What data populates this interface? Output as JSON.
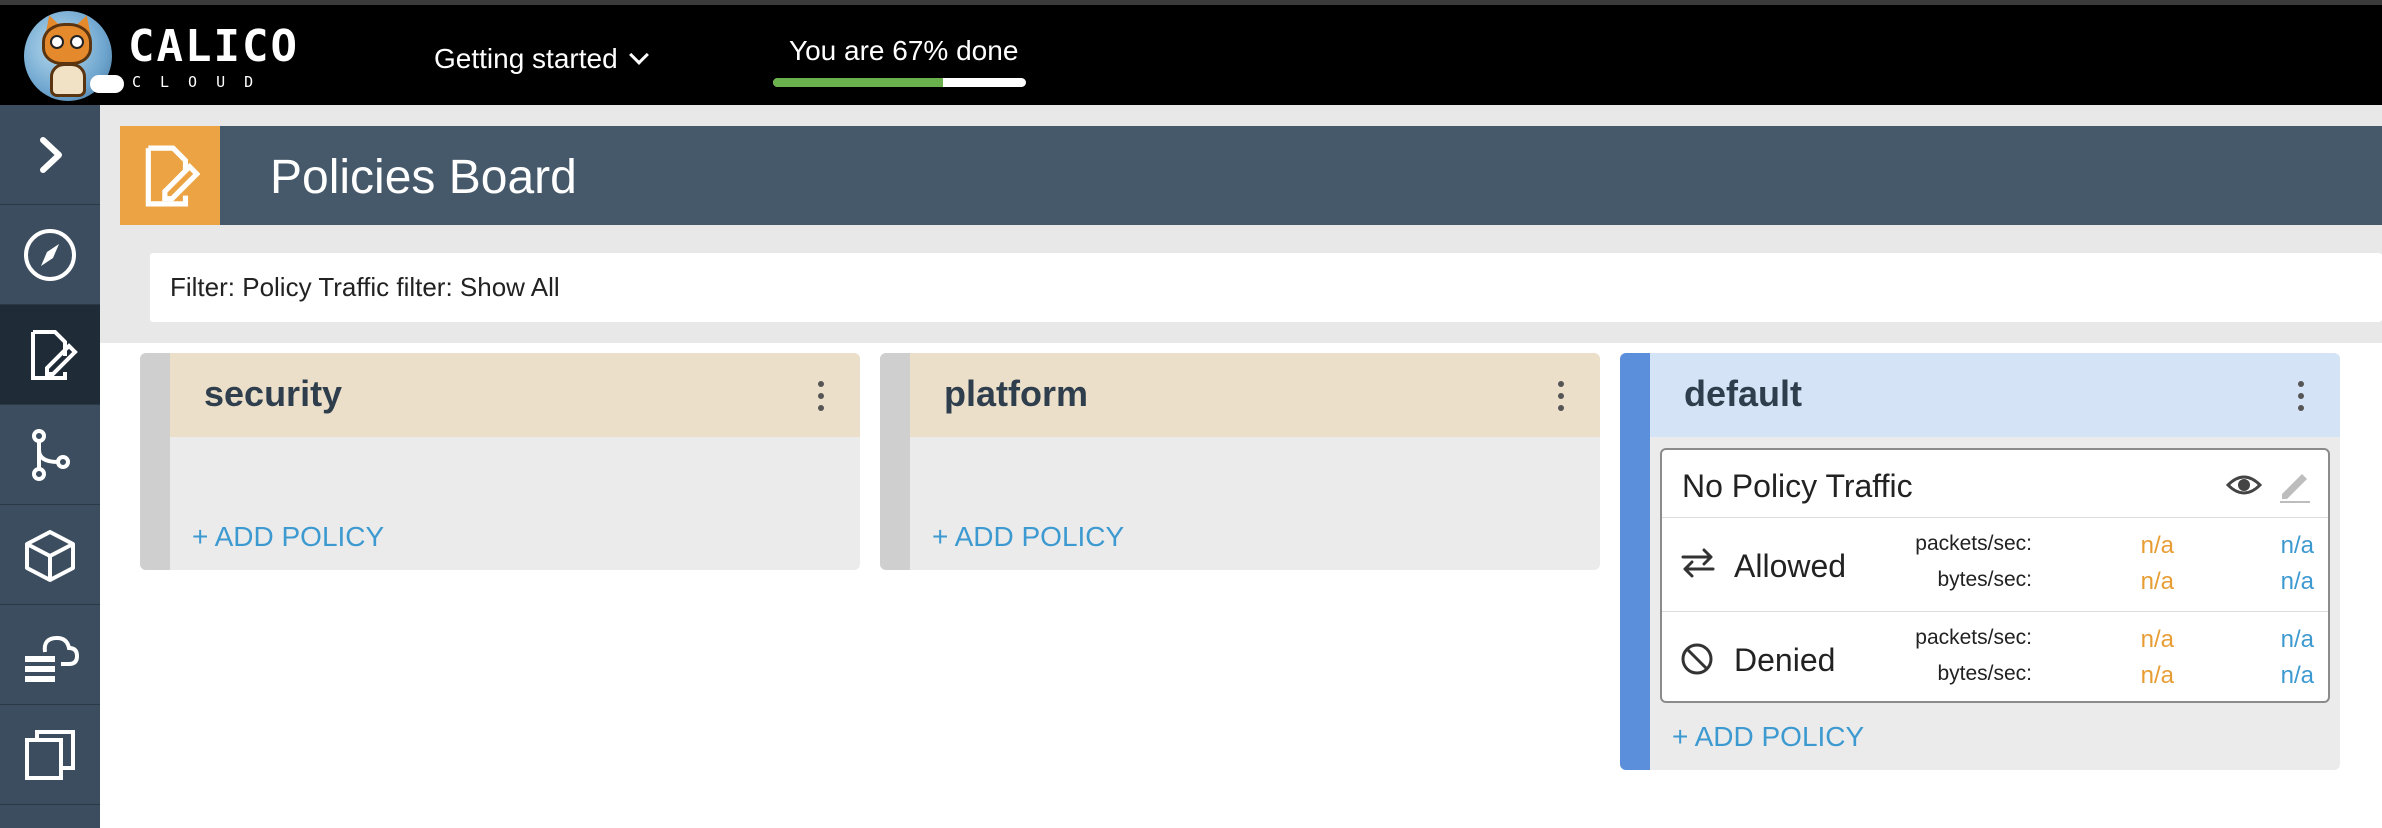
{
  "topbar": {
    "logo_text": "CALICO",
    "logo_sub": "CLOUD",
    "menu_label": "Getting started",
    "progress_text": "You are 67% done",
    "progress_fraction": 0.67,
    "progress_color": "#6ab04c"
  },
  "sidebar": {
    "items": [
      {
        "name": "expand",
        "icon": "chevron-right-icon"
      },
      {
        "name": "dashboard",
        "icon": "compass-icon"
      },
      {
        "name": "policies",
        "icon": "policy-edit-icon",
        "active": true
      },
      {
        "name": "service-graph",
        "icon": "graph-branch-icon"
      },
      {
        "name": "endpoints",
        "icon": "cube-icon"
      },
      {
        "name": "managed-cluster",
        "icon": "cloud-server-icon"
      },
      {
        "name": "copy",
        "icon": "copy-icon"
      }
    ]
  },
  "header": {
    "title": "Policies Board",
    "accent": "#eba344",
    "background": "#46596b"
  },
  "filter": {
    "text": "Filter: Policy Traffic filter: Show All"
  },
  "columns": [
    {
      "title": "security",
      "add_label": "+ ADD POLICY"
    },
    {
      "title": "platform",
      "add_label": "+ ADD POLICY"
    },
    {
      "title": "default",
      "add_label": "+ ADD POLICY",
      "card": {
        "title": "No Policy Traffic",
        "rows": [
          {
            "label": "Allowed",
            "icon": "swap-arrows-icon",
            "metrics": [
              {
                "label": "packets/sec:",
                "a": "n/a",
                "b": "n/a"
              },
              {
                "label": "bytes/sec:",
                "a": "n/a",
                "b": "n/a"
              }
            ]
          },
          {
            "label": "Denied",
            "icon": "blocked-circle-icon",
            "metrics": [
              {
                "label": "packets/sec:",
                "a": "n/a",
                "b": "n/a"
              },
              {
                "label": "bytes/sec:",
                "a": "n/a",
                "b": "n/a"
              }
            ]
          }
        ]
      }
    }
  ]
}
